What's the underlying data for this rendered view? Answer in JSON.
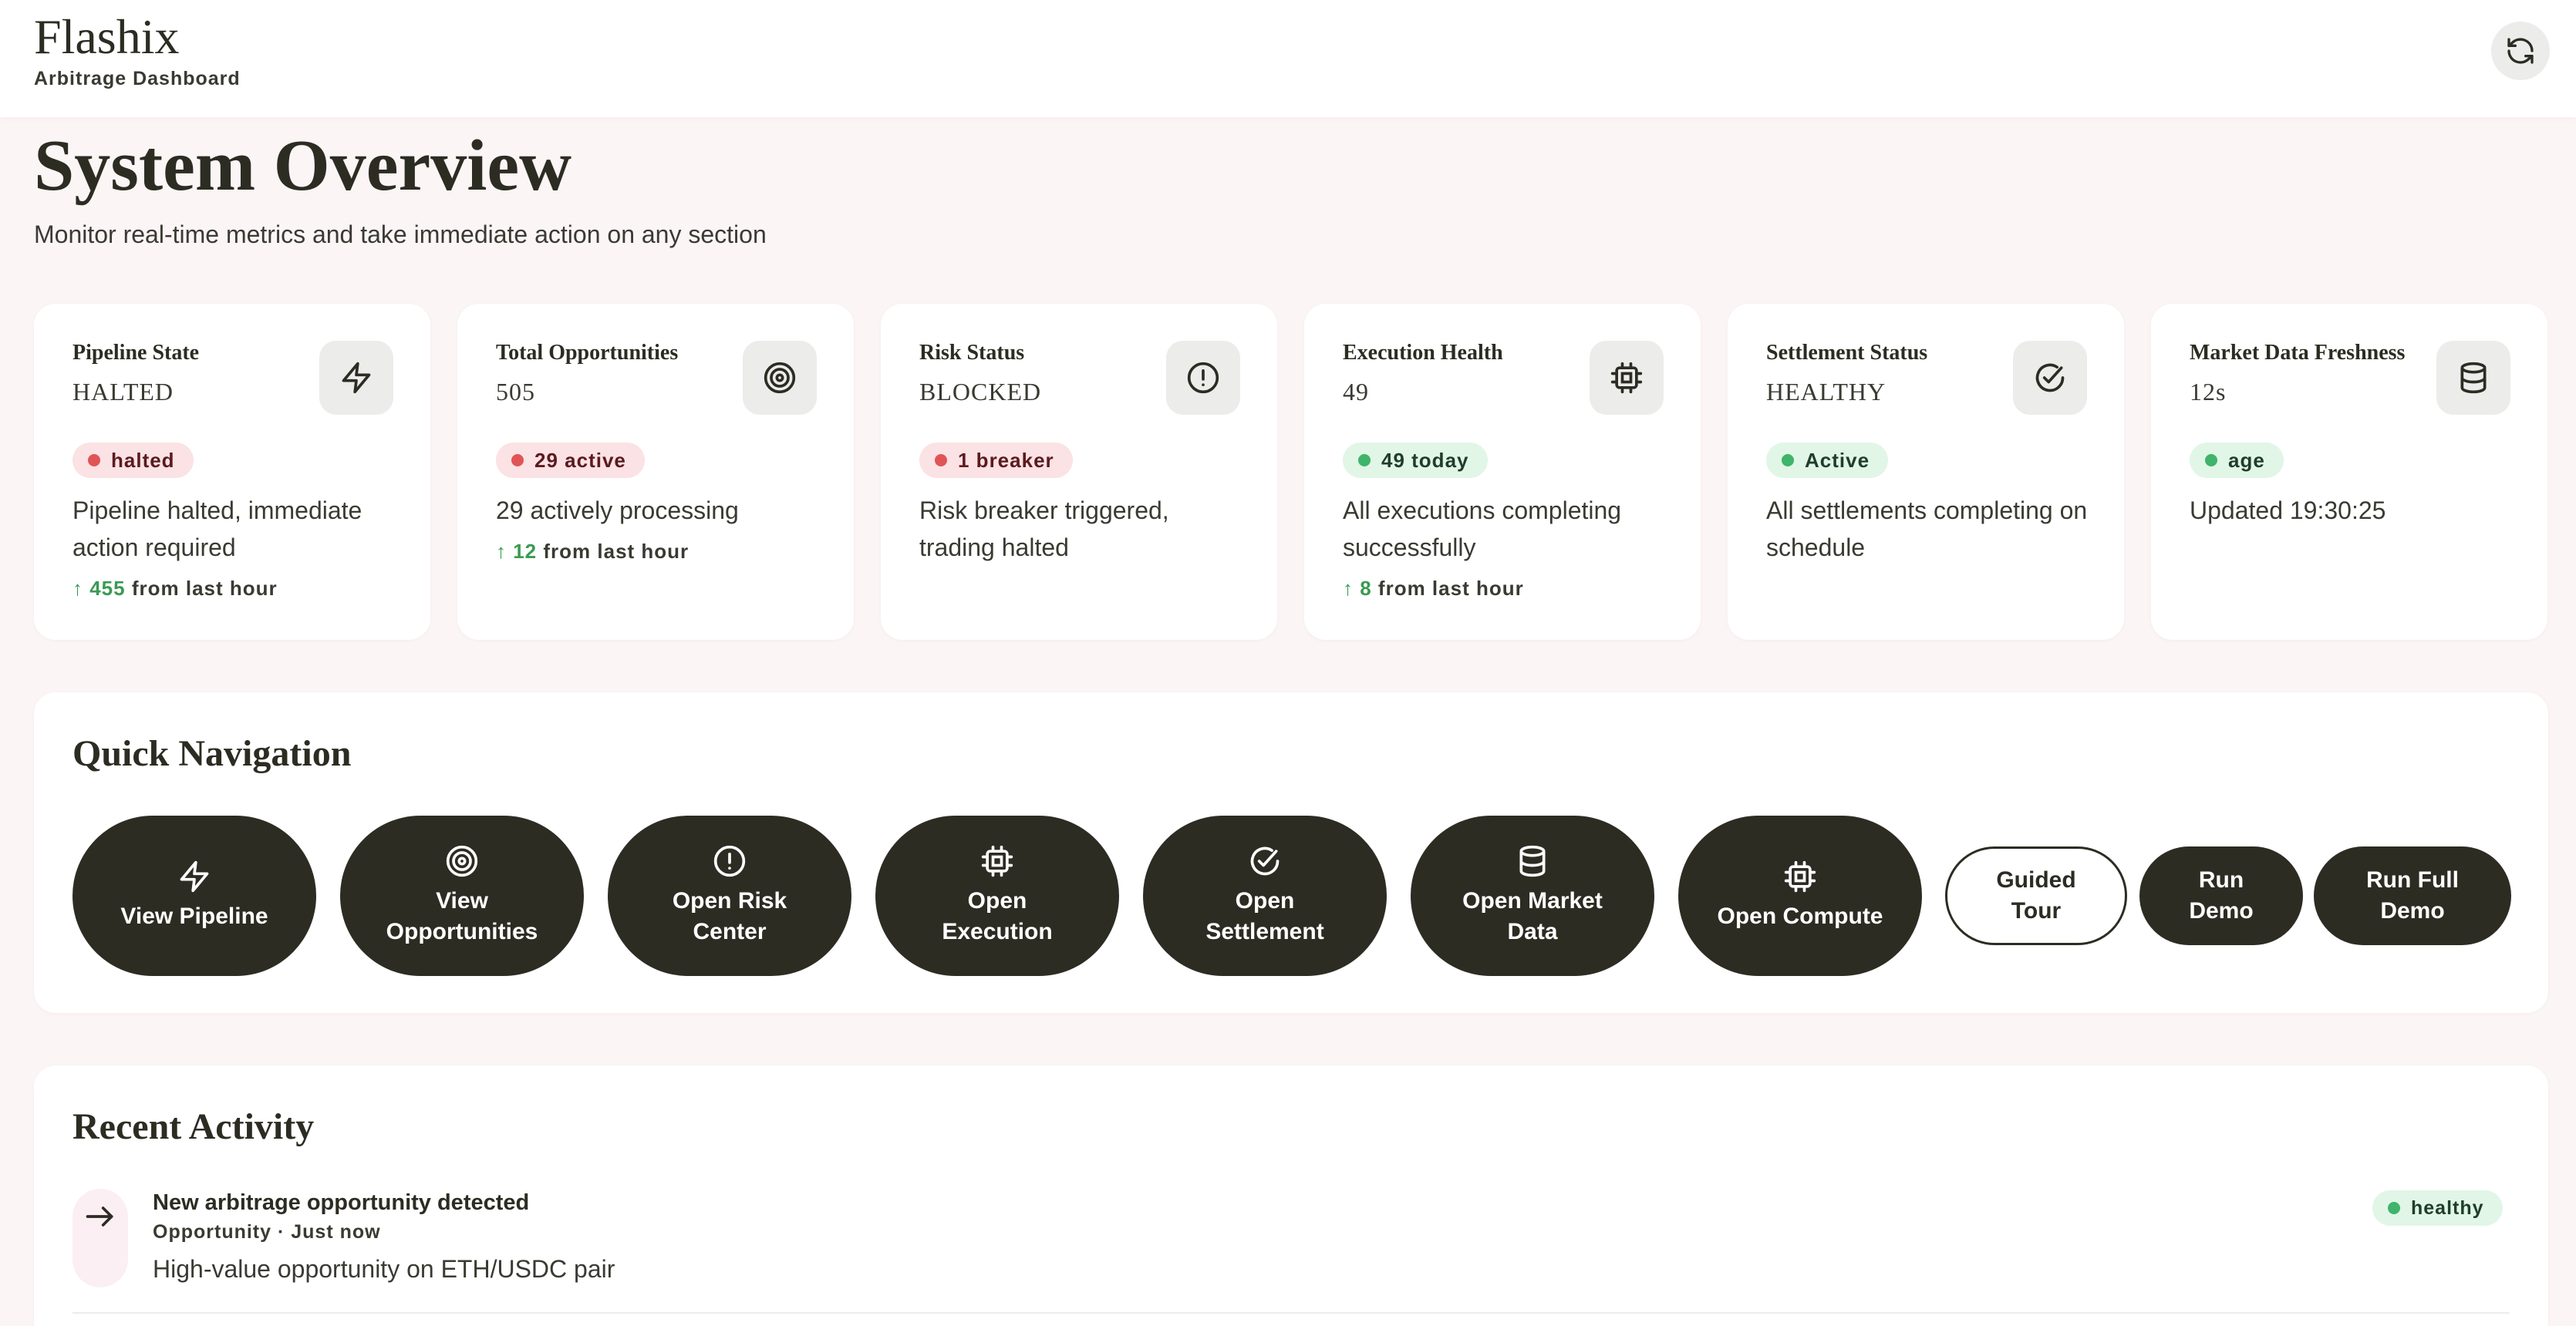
{
  "header": {
    "brand": "Flashix",
    "subtitle": "Arbitrage Dashboard",
    "refresh_icon": "refresh-icon"
  },
  "page": {
    "title": "System Overview",
    "subtitle": "Monitor real-time metrics and take immediate action on any section"
  },
  "metrics": [
    {
      "label": "Pipeline State",
      "value": "HALTED",
      "icon": "lightning-icon",
      "badge": "halted",
      "badge_tone": "red",
      "desc": "Pipeline halted, immediate action required",
      "trend_value": "↑ 455",
      "trend_text": "from last hour"
    },
    {
      "label": "Total Opportunities",
      "value": "505",
      "icon": "target-icon",
      "badge": "29 active",
      "badge_tone": "red",
      "desc": "29 actively processing",
      "trend_value": "↑ 12",
      "trend_text": "from last hour"
    },
    {
      "label": "Risk Status",
      "value": "BLOCKED",
      "icon": "alert-circle-icon",
      "badge": "1 breaker",
      "badge_tone": "red",
      "desc": "Risk breaker triggered, trading halted"
    },
    {
      "label": "Execution Health",
      "value": "49",
      "icon": "cpu-icon",
      "badge": "49 today",
      "badge_tone": "green",
      "desc": "All executions completing successfully",
      "trend_value": "↑ 8",
      "trend_text": "from last hour"
    },
    {
      "label": "Settlement Status",
      "value": "HEALTHY",
      "icon": "check-circle-icon",
      "badge": "Active",
      "badge_tone": "green",
      "desc": "All settlements completing on schedule"
    },
    {
      "label": "Market Data Freshness",
      "value": "12s",
      "icon": "database-icon",
      "badge": "age",
      "badge_tone": "green",
      "desc": "Updated 19:30:25"
    }
  ],
  "quick_nav": {
    "title": "Quick Navigation",
    "buttons": [
      {
        "label_line1": "View Pipeline",
        "label_line2": "",
        "icon": "lightning-icon"
      },
      {
        "label_line1": "View",
        "label_line2": "Opportunities",
        "icon": "target-icon"
      },
      {
        "label_line1": "Open Risk",
        "label_line2": "Center",
        "icon": "alert-circle-icon"
      },
      {
        "label_line1": "Open",
        "label_line2": "Execution",
        "icon": "cpu-icon"
      },
      {
        "label_line1": "Open",
        "label_line2": "Settlement",
        "icon": "check-circle-icon"
      },
      {
        "label_line1": "Open Market",
        "label_line2": "Data",
        "icon": "database-icon"
      },
      {
        "label_line1": "Open Compute",
        "label_line2": "",
        "icon": "cpu-icon"
      }
    ],
    "actions": [
      {
        "label_line1": "Guided",
        "label_line2": "Tour"
      },
      {
        "label_line1": "Run",
        "label_line2": "Demo"
      },
      {
        "label_line1": "Run Full",
        "label_line2": "Demo"
      }
    ]
  },
  "recent_activity": {
    "title": "Recent Activity",
    "items": [
      {
        "icon": "arrow-right-icon",
        "title": "New arbitrage opportunity detected",
        "meta": "Opportunity · Just now",
        "desc": "High-value opportunity on ETH/USDC pair",
        "status": "healthy"
      }
    ]
  }
}
